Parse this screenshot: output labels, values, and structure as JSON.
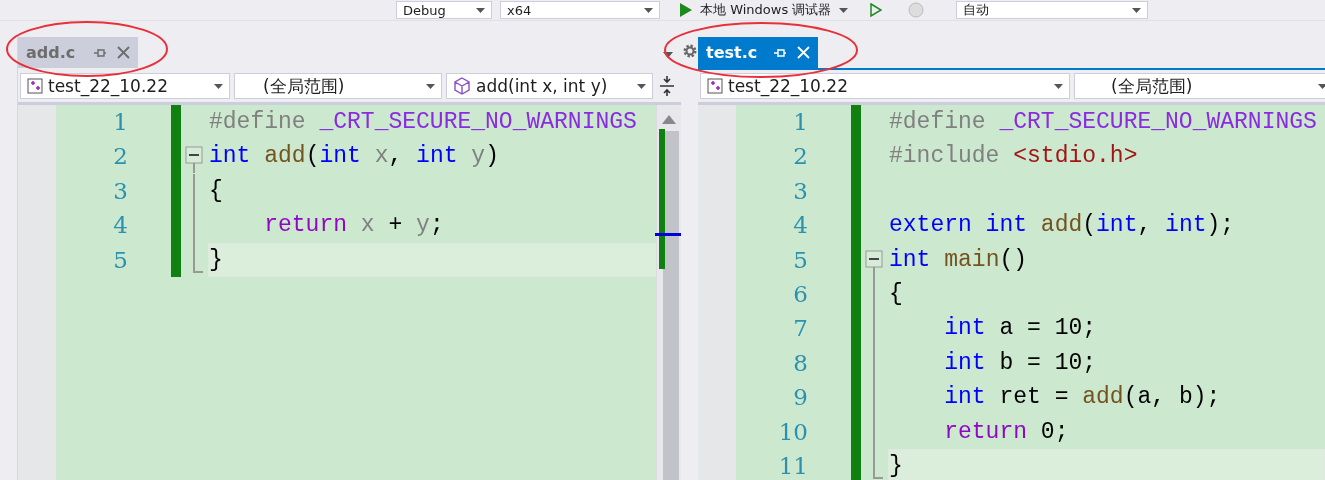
{
  "toolbar": {
    "configuration": "Debug",
    "platform": "x64",
    "run_label": "本地 Windows 调试器",
    "mode": "自动"
  },
  "panes": [
    {
      "tab": {
        "label": "add.c",
        "selected": false
      },
      "nav": {
        "project": "test_22_10.22",
        "scope": "(全局范围)",
        "member": "add(int x, int y)"
      },
      "lines": [
        {
          "number": "1",
          "current": false,
          "tokens": [
            {
              "kind": "preproc",
              "text": "#define "
            },
            {
              "kind": "macro",
              "text": "_CRT_SECURE_NO_WARNINGS"
            }
          ]
        },
        {
          "number": "2",
          "current": false,
          "tokens": [
            {
              "kind": "keyword",
              "text": "int "
            },
            {
              "kind": "func",
              "text": "add"
            },
            {
              "kind": "plain",
              "text": "("
            },
            {
              "kind": "keyword",
              "text": "int "
            },
            {
              "kind": "param",
              "text": "x"
            },
            {
              "kind": "plain",
              "text": ", "
            },
            {
              "kind": "keyword",
              "text": "int "
            },
            {
              "kind": "param",
              "text": "y"
            },
            {
              "kind": "plain",
              "text": ")"
            }
          ],
          "children": [
            {
              "number": "3",
              "current": false,
              "tokens": [
                {
                  "kind": "plain",
                  "text": "{"
                }
              ]
            },
            {
              "number": "4",
              "current": false,
              "tokens": [
                {
                  "kind": "control",
                  "text": "    return "
                },
                {
                  "kind": "param",
                  "text": "x"
                },
                {
                  "kind": "plain",
                  "text": " + "
                },
                {
                  "kind": "param",
                  "text": "y"
                },
                {
                  "kind": "plain",
                  "text": ";"
                }
              ]
            },
            {
              "number": "5",
              "current": true,
              "tokens": [
                {
                  "kind": "plain",
                  "text": "}"
                }
              ]
            }
          ]
        }
      ]
    },
    {
      "tab": {
        "label": "test.c",
        "selected": true
      },
      "nav": {
        "project": "test_22_10.22",
        "scope": "(全局范围)"
      },
      "lines": [
        {
          "number": "1",
          "current": false,
          "tokens": [
            {
              "kind": "preproc",
              "text": "#define "
            },
            {
              "kind": "macro",
              "text": "_CRT_SECURE_NO_WARNINGS"
            }
          ]
        },
        {
          "number": "2",
          "current": false,
          "tokens": [
            {
              "kind": "preproc",
              "text": "#include "
            },
            {
              "kind": "include",
              "text": "<stdio.h>"
            }
          ]
        },
        {
          "number": "3",
          "current": false
        },
        {
          "number": "4",
          "current": false,
          "tokens": [
            {
              "kind": "keyword",
              "text": "extern int "
            },
            {
              "kind": "func",
              "text": "add"
            },
            {
              "kind": "plain",
              "text": "("
            },
            {
              "kind": "keyword",
              "text": "int"
            },
            {
              "kind": "plain",
              "text": ", "
            },
            {
              "kind": "keyword",
              "text": "int"
            },
            {
              "kind": "plain",
              "text": ");"
            }
          ]
        },
        {
          "number": "5",
          "current": false,
          "tokens": [
            {
              "kind": "keyword",
              "text": "int "
            },
            {
              "kind": "func",
              "text": "main"
            },
            {
              "kind": "plain",
              "text": "()"
            }
          ],
          "children": [
            {
              "number": "6",
              "current": false,
              "tokens": [
                {
                  "kind": "plain",
                  "text": "{"
                }
              ]
            },
            {
              "number": "7",
              "current": false,
              "tokens": [
                {
                  "kind": "keyword",
                  "text": "    int "
                },
                {
                  "kind": "plain",
                  "text": "a = 10;"
                }
              ]
            },
            {
              "number": "8",
              "current": false,
              "tokens": [
                {
                  "kind": "keyword",
                  "text": "    int "
                },
                {
                  "kind": "plain",
                  "text": "b = 10;"
                }
              ]
            },
            {
              "number": "9",
              "current": false,
              "tokens": [
                {
                  "kind": "keyword",
                  "text": "    int "
                },
                {
                  "kind": "plain",
                  "text": "ret = "
                },
                {
                  "kind": "func",
                  "text": "add"
                },
                {
                  "kind": "plain",
                  "text": "(a, b);"
                }
              ]
            },
            {
              "number": "10",
              "current": false,
              "tokens": [
                {
                  "kind": "control",
                  "text": "    return "
                },
                {
                  "kind": "plain",
                  "text": "0;"
                }
              ]
            },
            {
              "number": "11",
              "current": true,
              "tokens": [
                {
                  "kind": "plain",
                  "text": "}"
                }
              ]
            }
          ]
        }
      ]
    }
  ]
}
